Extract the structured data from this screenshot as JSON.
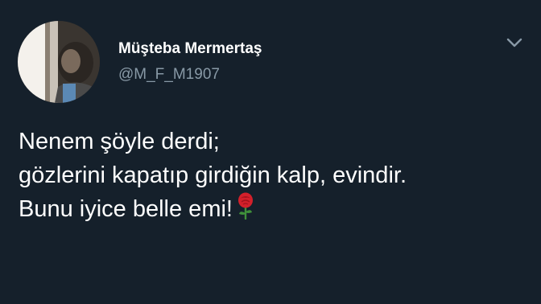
{
  "author": {
    "display_name": "Müşteba Mermertaş",
    "handle": "@M_F_M1907",
    "avatar_icon": "profile-photo"
  },
  "menu": {
    "icon": "chevron-down-icon"
  },
  "tweet": {
    "lines": [
      "Nenem şöyle derdi;",
      "gözlerini kapatıp girdiğin kalp, evindir.",
      "Bunu iyice belle emi!"
    ],
    "trailing_emoji": "rose-icon"
  },
  "colors": {
    "background": "#15202b",
    "text_primary": "#ffffff",
    "text_secondary": "#8899a6"
  }
}
